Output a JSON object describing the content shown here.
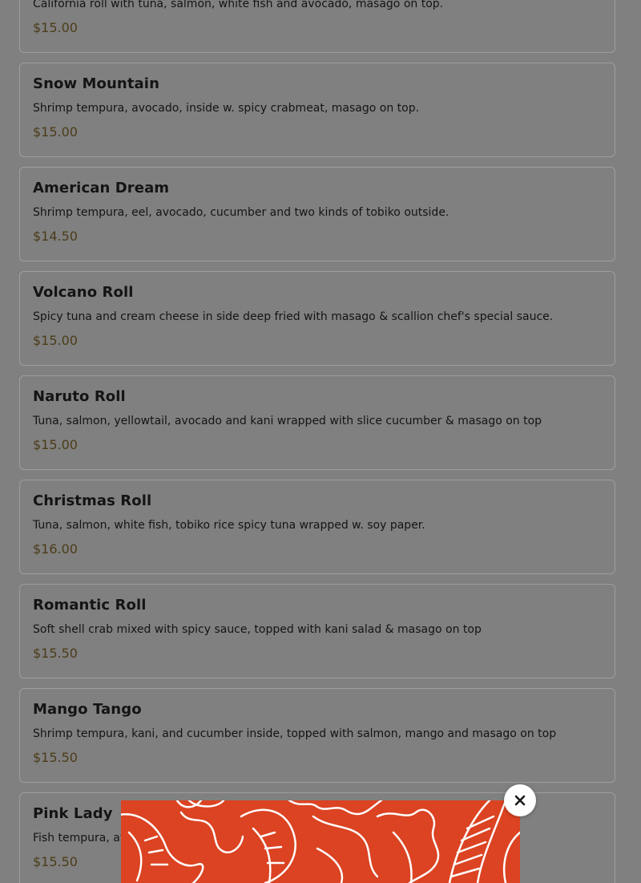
{
  "menu": {
    "items": [
      {
        "name": "",
        "description": "California roll with tuna, salmon, white fish and avocado, masago on top.",
        "price": "$15.00"
      },
      {
        "name": "Snow Mountain",
        "description": "Shrimp tempura, avocado, inside w. spicy crabmeat, masago on top.",
        "price": "$15.00"
      },
      {
        "name": "American Dream",
        "description": "Shrimp tempura, eel, avocado, cucumber and two kinds of tobiko outside.",
        "price": "$14.50"
      },
      {
        "name": "Volcano Roll",
        "description": "Spicy tuna and cream cheese in side deep fried with masago & scallion chef's special sauce.",
        "price": "$15.00"
      },
      {
        "name": "Naruto Roll",
        "description": "Tuna, salmon, yellowtail, avocado and kani wrapped with slice cucumber & masago on top",
        "price": "$15.00"
      },
      {
        "name": "Christmas Roll",
        "description": "Tuna, salmon, white fish, tobiko rice spicy tuna wrapped w. soy paper.",
        "price": "$16.00"
      },
      {
        "name": "Romantic Roll",
        "description": "Soft shell crab mixed with spicy sauce, topped with kani salad & masago on top",
        "price": "$15.50"
      },
      {
        "name": "Mango Tango",
        "description": "Shrimp tempura, kani, and cucumber inside, topped with salmon, mango and masago on top",
        "price": "$15.50"
      },
      {
        "name": "Pink Lady",
        "description": "Fish tempura, avo",
        "price": "$15.50"
      }
    ]
  },
  "popup": {
    "close_icon": "close-icon",
    "pattern_icon": "leaf-pattern",
    "background_color": "#db4322"
  },
  "colors": {
    "overlay_background": "#808080",
    "text": "#141414",
    "price": "#4b3c19",
    "card_border": "#9e9e9e"
  }
}
